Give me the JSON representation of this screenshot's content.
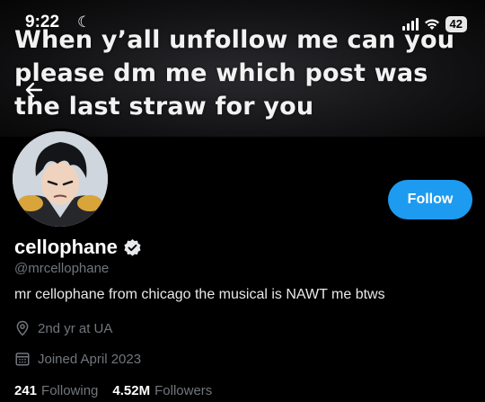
{
  "status_bar": {
    "time": "9:22",
    "battery": "42"
  },
  "banner": {
    "text": "When y’all unfollow me can you please dm me which post was the last straw for you"
  },
  "profile": {
    "display_name": "cellophane",
    "handle": "@mrcellophane",
    "bio": "mr cellophane from chicago the musical is NAWT me btws",
    "location": "2nd yr at UA",
    "joined": "Joined April 2023",
    "following_count": "241",
    "following_label": "Following",
    "followers_count": "4.52M",
    "followers_label": "Followers",
    "verified_icon": "verified-badge-icon"
  },
  "actions": {
    "follow_label": "Follow"
  },
  "colors": {
    "accent": "#1d9bf0",
    "background": "#000000",
    "muted": "#71767b"
  }
}
